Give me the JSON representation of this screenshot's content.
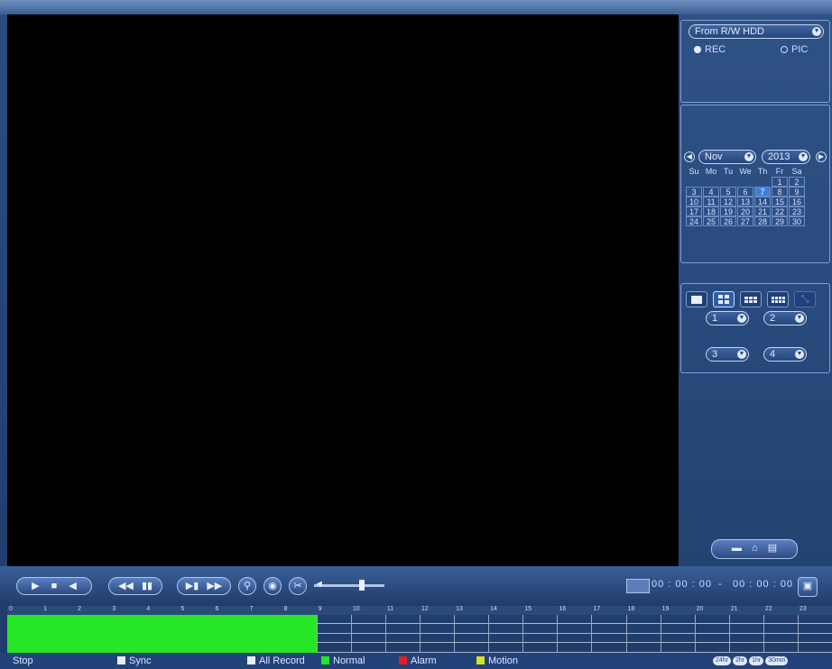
{
  "source": {
    "selected": "From R/W HDD"
  },
  "mode": {
    "rec_label": "REC",
    "pic_label": "PIC",
    "selected": "REC"
  },
  "calendar": {
    "month": "Nov",
    "year": "2013",
    "weekdays": [
      "Su",
      "Mo",
      "Tu",
      "We",
      "Th",
      "Fr",
      "Sa"
    ],
    "rows": [
      [
        "",
        "",
        "",
        "",
        "",
        "1",
        "2"
      ],
      [
        "3",
        "4",
        "5",
        "6",
        "7",
        "8",
        "9"
      ],
      [
        "10",
        "11",
        "12",
        "13",
        "14",
        "15",
        "16"
      ],
      [
        "17",
        "18",
        "19",
        "20",
        "21",
        "22",
        "23"
      ],
      [
        "24",
        "25",
        "26",
        "27",
        "28",
        "29",
        "30"
      ]
    ],
    "selected_day": "7"
  },
  "channels": [
    "1",
    "2",
    "3",
    "4"
  ],
  "controls": {
    "time_start": "00 : 00 : 00",
    "time_sep": "-",
    "time_end": "00 : 00 : 00"
  },
  "timeline": {
    "hours": [
      "0",
      "1",
      "2",
      "3",
      "4",
      "5",
      "6",
      "7",
      "8",
      "9",
      "10",
      "11",
      "12",
      "13",
      "14",
      "15",
      "16",
      "17",
      "18",
      "19",
      "20",
      "21",
      "22",
      "23"
    ],
    "recorded_fraction": 0.375
  },
  "legend": {
    "stop": "Stop",
    "sync": "Sync",
    "all_record": "All Record",
    "normal": "Normal",
    "alarm": "Alarm",
    "motion": "Motion",
    "zoom": [
      "24hr",
      "2hr",
      "1hr",
      "30min"
    ]
  },
  "colors": {
    "normal": "#27e627",
    "alarm": "#e02020",
    "motion": "#d8e02a",
    "accent": "#3f7fe0"
  }
}
